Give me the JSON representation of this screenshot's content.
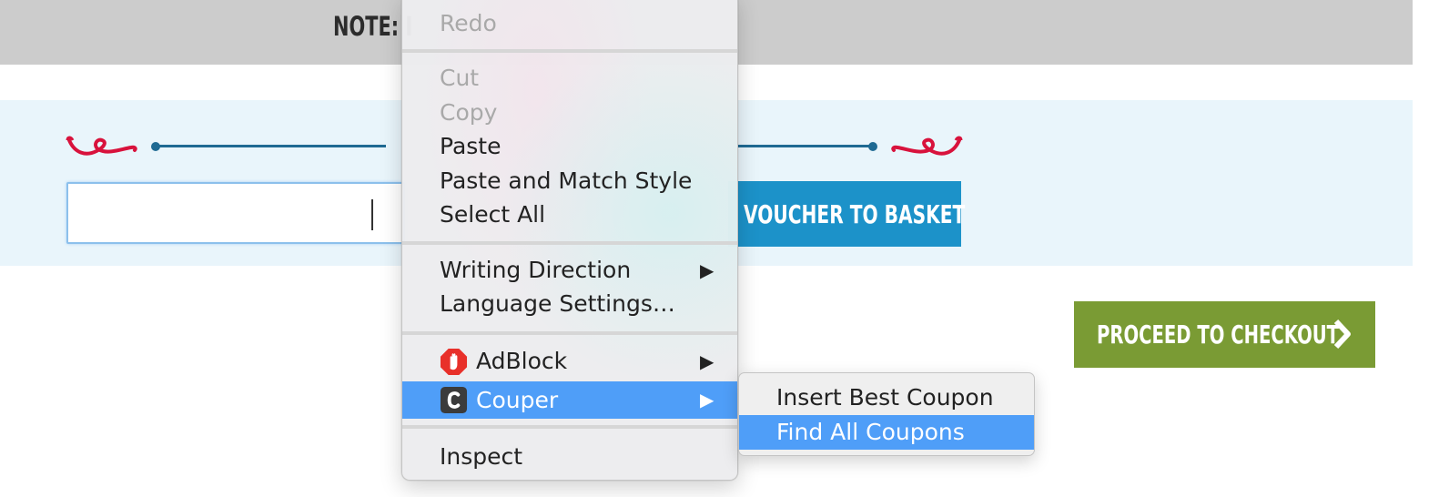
{
  "page": {
    "note_text": "NOTE: I",
    "add_voucher_label": "VOUCHER TO BASKET",
    "checkout_label": "PROCEED TO CHECKOUT",
    "voucher_input_value": ""
  },
  "context_menu": {
    "items": [
      {
        "label": "Redo",
        "enabled": false
      },
      {
        "label": "Cut",
        "enabled": false
      },
      {
        "label": "Copy",
        "enabled": false
      },
      {
        "label": "Paste",
        "enabled": true
      },
      {
        "label": "Paste and Match Style",
        "enabled": true
      },
      {
        "label": "Select All",
        "enabled": true
      },
      {
        "label": "Writing Direction",
        "enabled": true,
        "submenu": true
      },
      {
        "label": "Language Settings…",
        "enabled": true
      },
      {
        "label": "AdBlock",
        "enabled": true,
        "submenu": true,
        "icon": "adblock-icon"
      },
      {
        "label": "Couper",
        "enabled": true,
        "submenu": true,
        "icon": "couper-icon",
        "highlighted": true
      },
      {
        "label": "Inspect",
        "enabled": true
      }
    ],
    "submenu_arrow": "▶"
  },
  "couper_submenu": {
    "items": [
      {
        "label": "Insert Best Coupon",
        "highlighted": false
      },
      {
        "label": "Find All Coupons",
        "highlighted": true
      }
    ]
  },
  "colors": {
    "highlight": "#4f9ef8",
    "voucher_button": "#1c92c9",
    "checkout_button": "#7a9b34",
    "ornament": "#d8123c",
    "rule": "#1f6a93"
  }
}
